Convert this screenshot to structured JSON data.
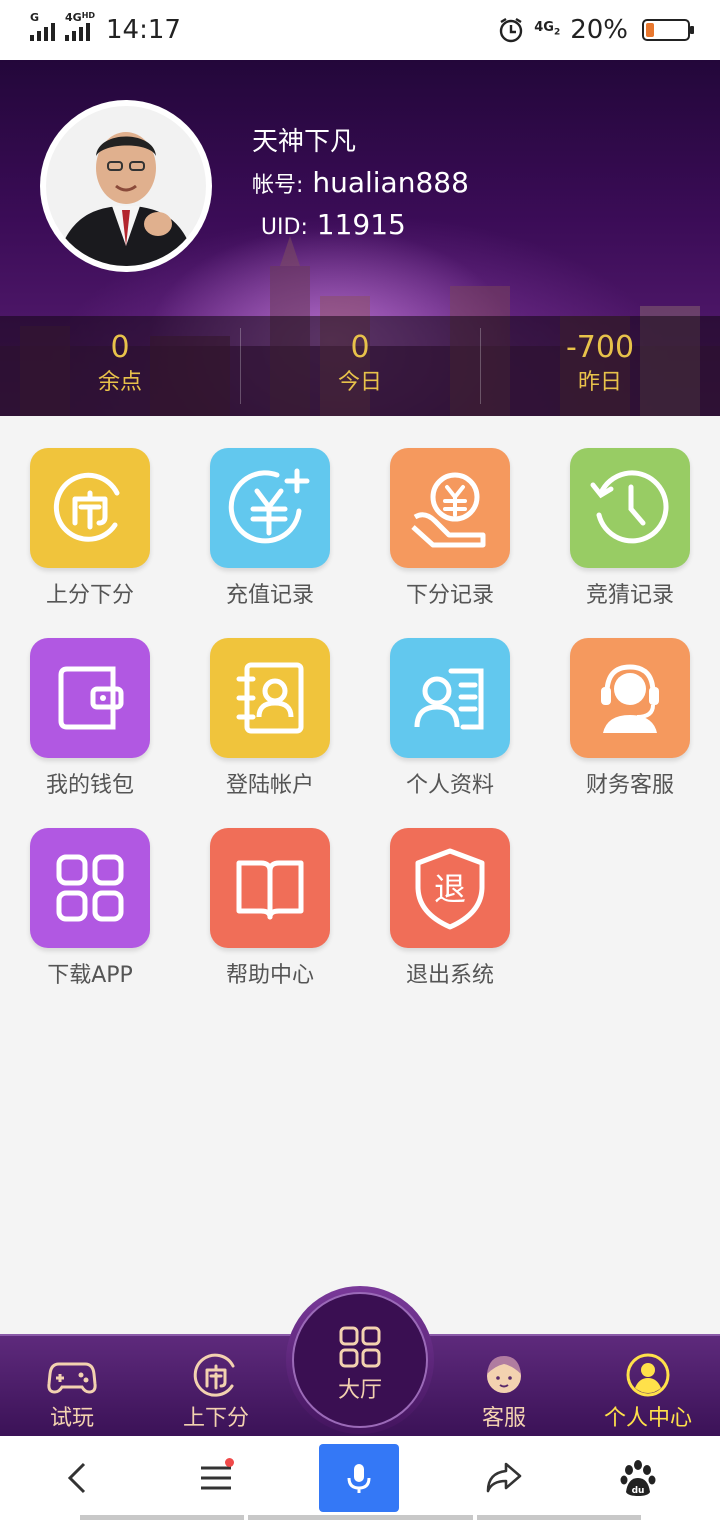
{
  "status": {
    "network1": "G",
    "network2": "4G",
    "network2_sup": "HD",
    "time": "14:17",
    "net3": "4G",
    "net3_sub": "2",
    "battery": "20%",
    "battery_level": 0.2,
    "battery_color": "#e8772e"
  },
  "profile": {
    "name": "天神下凡",
    "account_label": "帐号:",
    "account": "hualian888",
    "uid_label": "UID:",
    "uid": "11915"
  },
  "stats": [
    {
      "value": "0",
      "label": "余点"
    },
    {
      "value": "0",
      "label": "今日"
    },
    {
      "value": "-700",
      "label": "昨日"
    }
  ],
  "menu": [
    {
      "label": "上分下分",
      "icon": "coin-exchange-icon",
      "color": "#f0c43c"
    },
    {
      "label": "充值记录",
      "icon": "recharge-icon",
      "color": "#62c8ee"
    },
    {
      "label": "下分记录",
      "icon": "hand-coin-icon",
      "color": "#f5995e"
    },
    {
      "label": "竞猜记录",
      "icon": "history-clock-icon",
      "color": "#98cc64"
    },
    {
      "label": "我的钱包",
      "icon": "wallet-icon",
      "color": "#b158e2"
    },
    {
      "label": "登陆帐户",
      "icon": "account-book-icon",
      "color": "#f0c43c"
    },
    {
      "label": "个人资料",
      "icon": "profile-card-icon",
      "color": "#62c8ee"
    },
    {
      "label": "财务客服",
      "icon": "headset-agent-icon",
      "color": "#f5995e"
    },
    {
      "label": "下载APP",
      "icon": "apps-grid-icon",
      "color": "#b158e2"
    },
    {
      "label": "帮助中心",
      "icon": "open-book-icon",
      "color": "#f06e58"
    },
    {
      "label": "退出系统",
      "icon": "logout-shield-icon",
      "color": "#f06e58"
    }
  ],
  "bottom_nav": {
    "trial": "试玩",
    "transfer": "上下分",
    "hall": "大厅",
    "service": "客服",
    "personal": "个人中心",
    "active_color": "#ffe14a"
  },
  "browser_bar": {
    "icons": [
      "back-icon",
      "menu-icon",
      "voice-icon",
      "share-icon",
      "baidu-paw-icon"
    ],
    "accent": "#3478f6"
  }
}
